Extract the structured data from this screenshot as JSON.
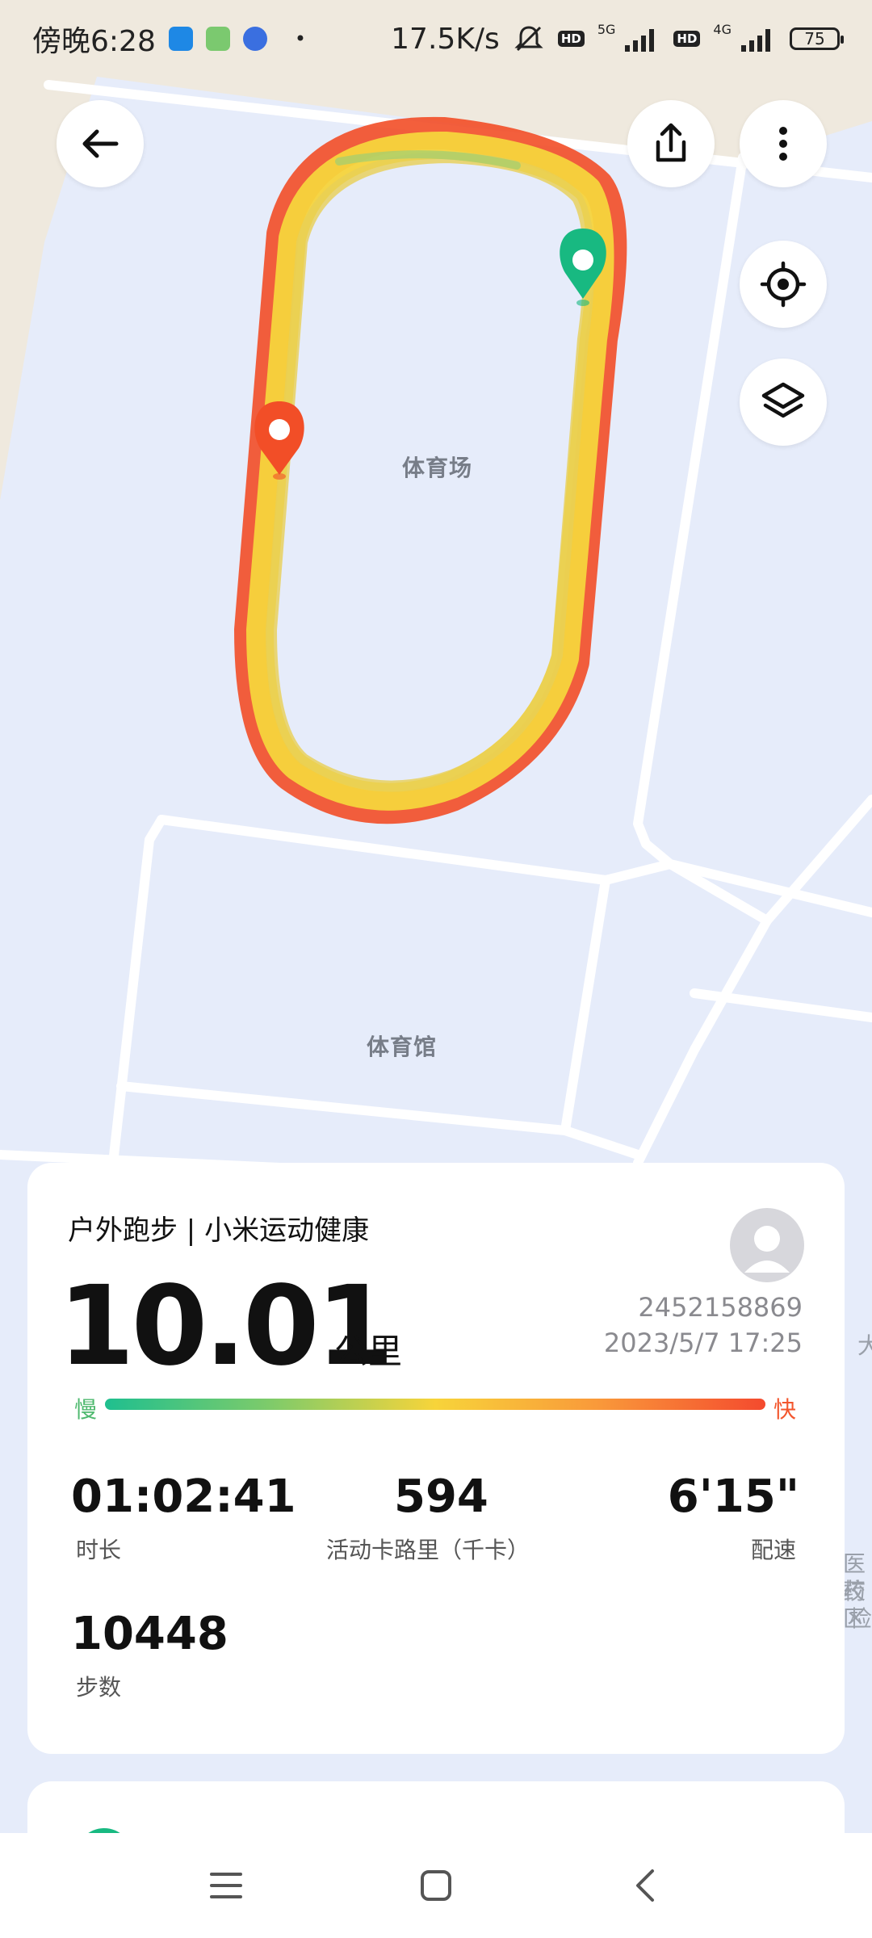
{
  "status_bar": {
    "time": "傍晚6:28",
    "net_speed": "17.5K/s",
    "net_type_1": "5G",
    "net_type_2": "4G",
    "hd_1": "HD",
    "hd_2": "HD",
    "battery": "75",
    "dot": "•"
  },
  "map": {
    "label_stadium": "体育场",
    "label_gym": "体育馆",
    "edge_labels": [
      "大",
      "医药",
      "校区",
      "检"
    ]
  },
  "toolbar": {
    "back_icon": "arrow-left-icon",
    "share_icon": "share-icon",
    "more_icon": "more-vertical-icon",
    "locate_icon": "locate-icon",
    "layers_icon": "layers-icon"
  },
  "workout": {
    "title": "户外跑步 | 小米运动健康",
    "distance": "10.01",
    "distance_unit": "公里",
    "user_id": "2452158869",
    "datetime": "2023/5/7 17:25",
    "speed_slow": "慢",
    "speed_fast": "快",
    "duration_value": "01:02:41",
    "duration_label": "时长",
    "calories_value": "594",
    "calories_label": "活动卡路里（千卡）",
    "pace_value": "6'15\"",
    "pace_label": "配速",
    "steps_value": "10448",
    "steps_label": "步数"
  },
  "colors": {
    "start_marker": "#18b981",
    "end_marker": "#f24e27",
    "route_yellow": "#f5d43c",
    "route_red": "#f24e27",
    "map_bg": "#e6ecfa",
    "land": "#efe9de"
  },
  "nav": {
    "menu_icon": "menu-icon",
    "home_icon": "home-square-icon",
    "back_icon": "chevron-left-icon"
  }
}
